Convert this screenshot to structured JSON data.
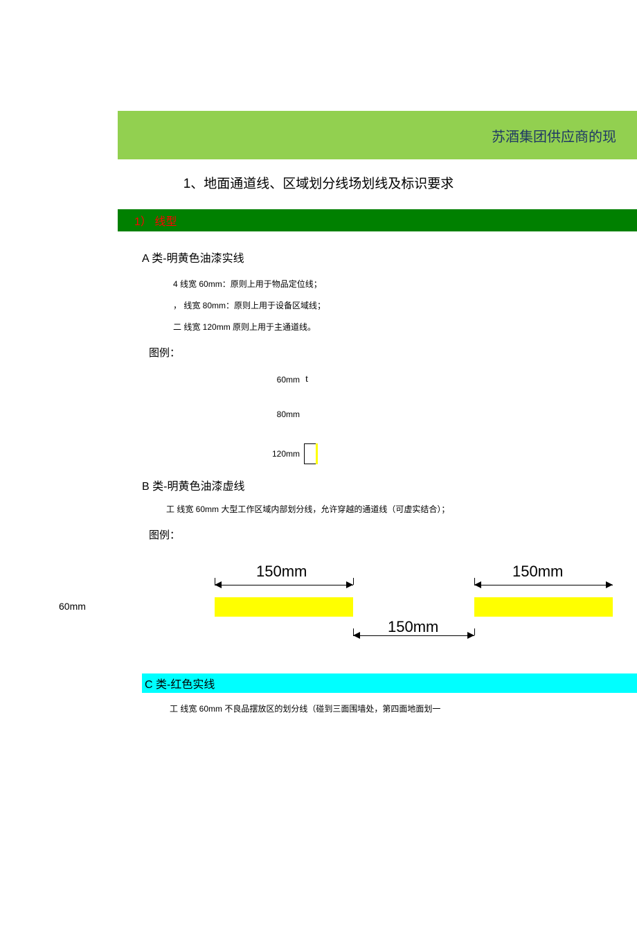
{
  "header": {
    "banner_text": "苏酒集团供应商的现"
  },
  "section1": {
    "title_num": "1、",
    "title_text": "地面通道线、区域划分线场划线及标识要求"
  },
  "bar1": {
    "label": "1）  线型"
  },
  "typeA": {
    "heading": "A 类-明黄色油漆实线",
    "spec1_prefix": "4 线宽 ",
    "spec1_width": "60mm",
    "spec1_suffix": "：原则上用于物品定位线；",
    "spec2_prefix": "，  线宽 ",
    "spec2_width": "80mm",
    "spec2_suffix": "：原则上用于设备区域线；",
    "spec3_prefix": "二  线宽 ",
    "spec3_width": "120mm",
    "spec3_suffix": " 原则上用于主通道线。",
    "legend": "图例：",
    "d60": "60mm",
    "d60_suffix": "t",
    "d80": "80mm",
    "d120": "120mm"
  },
  "typeB": {
    "heading": "B 类-明黄色油漆虚线",
    "spec_prefix": "工  线宽 ",
    "spec_width": "60mm",
    "spec_suffix": " 大型工作区域内部划分线，允许穿越的通道线（可虚实结合）；",
    "legend": "图例：",
    "dim_top_left": "150mm",
    "dim_top_right": "150mm",
    "dim_bottom": "150mm",
    "side_label": "60mm"
  },
  "typeC": {
    "heading": "C 类-红色实线",
    "spec_prefix": "工  线宽 ",
    "spec_width": "60mm",
    "spec_suffix": " 不良品摆放区的划分线（碰到三面围墙处，第四面地面划一"
  }
}
